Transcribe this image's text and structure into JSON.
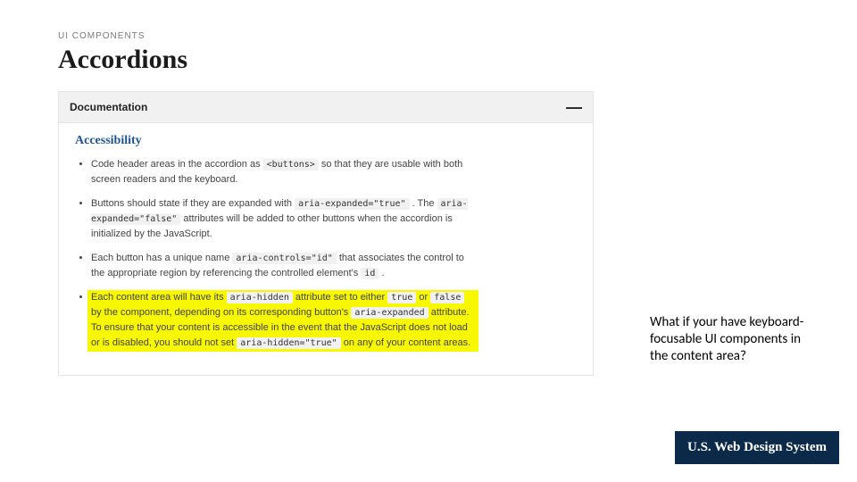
{
  "eyebrow": "UI COMPONENTS",
  "title": "Accordions",
  "accordion": {
    "header": "Documentation",
    "toggle_glyph": "—"
  },
  "section_heading": "Accessibility",
  "bullets": [
    {
      "highlight": false,
      "parts": [
        {
          "t": "text",
          "v": "Code header areas in the accordion as "
        },
        {
          "t": "code",
          "v": "<buttons>"
        },
        {
          "t": "text",
          "v": " so that they are usable with both screen readers and the keyboard."
        }
      ]
    },
    {
      "highlight": false,
      "parts": [
        {
          "t": "text",
          "v": "Buttons should state if they are expanded with "
        },
        {
          "t": "code",
          "v": "aria-expanded=\"true\""
        },
        {
          "t": "text",
          "v": " . The "
        },
        {
          "t": "code",
          "v": "aria-expanded=\"false\""
        },
        {
          "t": "text",
          "v": " attributes will be added to other buttons when the accordion is initialized by the JavaScript."
        }
      ]
    },
    {
      "highlight": false,
      "parts": [
        {
          "t": "text",
          "v": "Each button has a unique name "
        },
        {
          "t": "code",
          "v": "aria-controls=\"id\""
        },
        {
          "t": "text",
          "v": " that associates the control to the appropriate region by referencing the controlled element's "
        },
        {
          "t": "code",
          "v": "id"
        },
        {
          "t": "text",
          "v": " ."
        }
      ]
    },
    {
      "highlight": true,
      "parts": [
        {
          "t": "text",
          "v": "Each content area will have its "
        },
        {
          "t": "code",
          "v": "aria-hidden"
        },
        {
          "t": "text",
          "v": " attribute set to either "
        },
        {
          "t": "code",
          "v": "true"
        },
        {
          "t": "text",
          "v": " or "
        },
        {
          "t": "code",
          "v": "false"
        },
        {
          "t": "text",
          "v": " by the component, depending on its corresponding button's "
        },
        {
          "t": "code",
          "v": "aria-expanded"
        },
        {
          "t": "text",
          "v": " attribute. To ensure that your content is accessible in the event that the JavaScript does not load or is disabled, you should not set "
        },
        {
          "t": "code",
          "v": "aria-hidden=\"true\""
        },
        {
          "t": "text",
          "v": " on any of your content areas."
        }
      ]
    }
  ],
  "annotation": "What if your have keyboard-focusable UI components in the content area?",
  "footer": "U.S. Web Design System"
}
